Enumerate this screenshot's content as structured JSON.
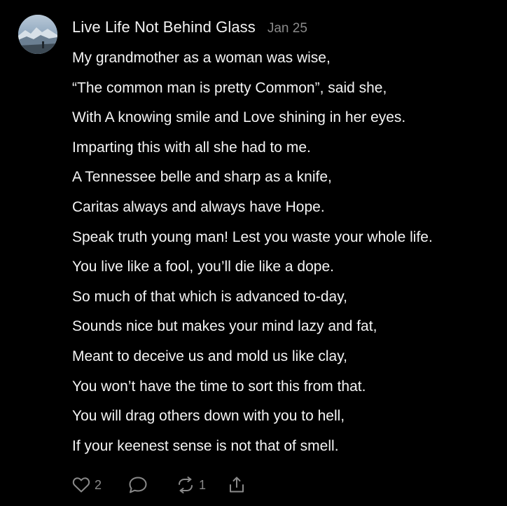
{
  "post": {
    "author": "Live Life Not Behind Glass",
    "date": "Jan 25",
    "lines": [
      "My grandmother as a woman was wise,",
      "“The common man is pretty Common”, said she,",
      "With A knowing smile and Love shining in her eyes.",
      "Imparting this with all she had to me.",
      "A Tennessee belle and sharp as a knife,",
      "Caritas always and always have Hope.",
      "Speak truth young man! Lest you waste your whole life.",
      "You live like a fool, you’ll die like a dope.",
      "So much of that which is advanced to-day,",
      "Sounds nice but makes your mind lazy and fat,",
      "Meant to deceive us and mold us like clay,",
      "You won’t have the time to sort this from that.",
      "You will drag others down with you to hell,",
      "If your keenest sense is not that of smell."
    ]
  },
  "actions": {
    "like_count": "2",
    "restack_count": "1"
  },
  "icons": {
    "like": "heart-icon",
    "comment": "comment-bubble-icon",
    "restack": "restack-arrows-icon",
    "share": "share-upload-icon"
  },
  "colors": {
    "background": "#000000",
    "text": "#f4f4f4",
    "muted": "#8a8a8a"
  }
}
